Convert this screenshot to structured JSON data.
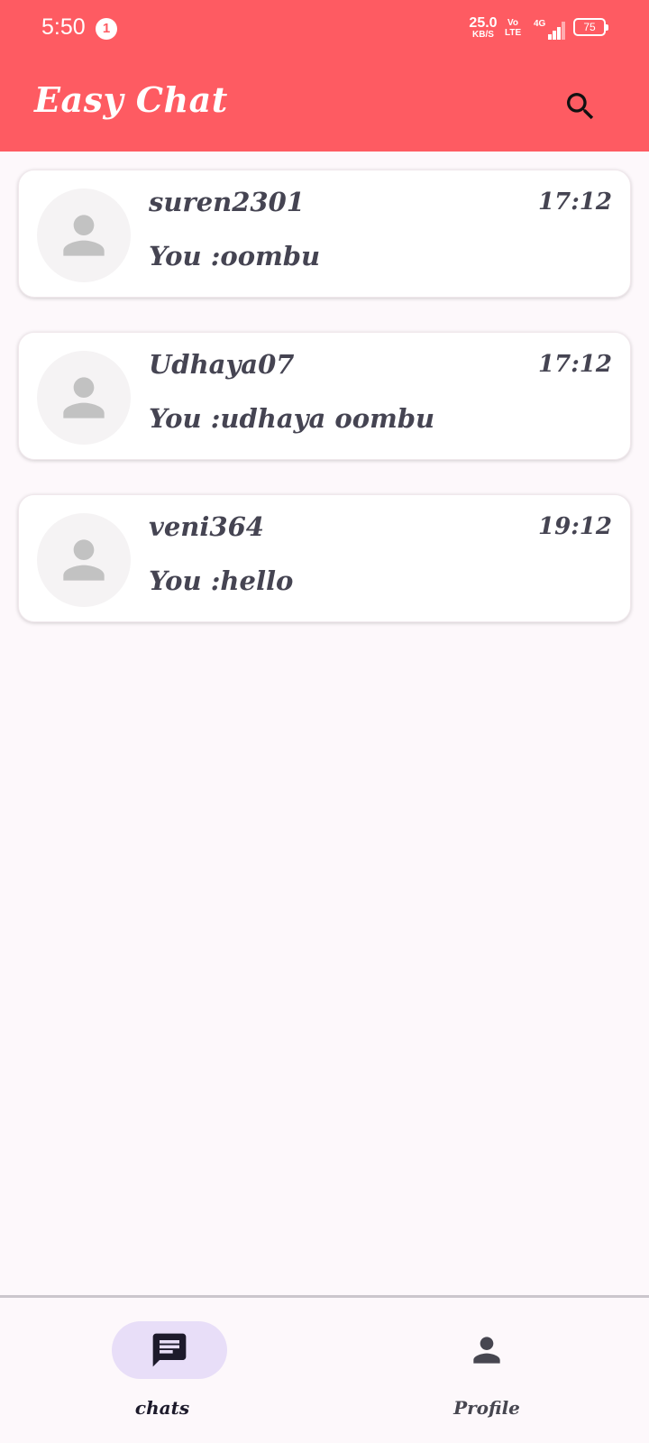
{
  "status_bar": {
    "time": "5:50",
    "notification_count": "1",
    "net_speed_value": "25.0",
    "net_speed_unit": "KB/S",
    "volte_line1": "Vo",
    "volte_line2": "LTE",
    "network": "4G",
    "battery": "75"
  },
  "app_bar": {
    "title": "Easy Chat",
    "search_icon": "search-icon"
  },
  "chats": [
    {
      "name": "suren2301",
      "time": "17:12",
      "preview": "You :oombu"
    },
    {
      "name": "Udhaya07",
      "time": "17:12",
      "preview": "You :udhaya oombu"
    },
    {
      "name": "veni364",
      "time": "19:12",
      "preview": "You :hello"
    }
  ],
  "bottom_nav": {
    "items": [
      {
        "label": "chats",
        "icon": "chat-icon",
        "selected": true
      },
      {
        "label": "Profile",
        "icon": "person-icon",
        "selected": false
      }
    ]
  },
  "colors": {
    "primary": "#fe5b62",
    "background": "#fdf8fb",
    "text": "#454452",
    "nav_selected_pill": "#e8def8"
  }
}
